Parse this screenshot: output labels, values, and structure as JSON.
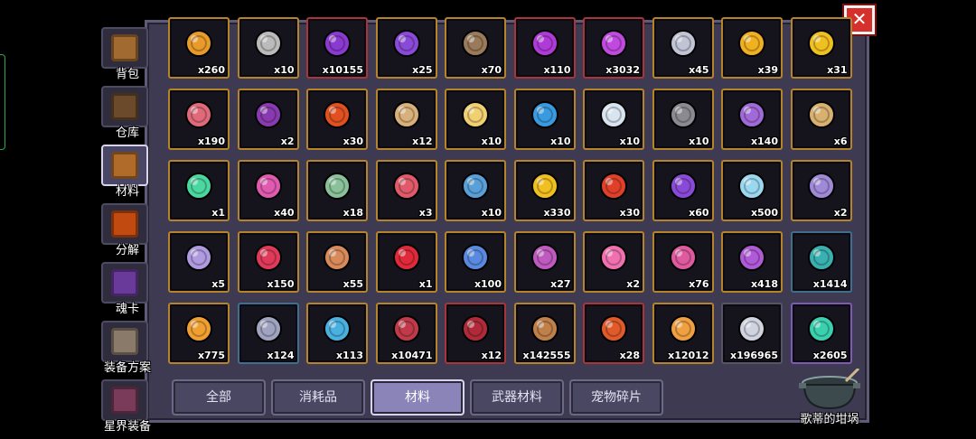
{
  "close_label": "✕",
  "side_tabs": [
    {
      "label": "背包",
      "icon": "chest-icon",
      "color": "#a06a30"
    },
    {
      "label": "仓库",
      "icon": "warehouse-icon",
      "color": "#6a4a2a"
    },
    {
      "label": "材料",
      "icon": "materials-icon",
      "color": "#b06a2a",
      "active": true
    },
    {
      "label": "分解",
      "icon": "salvage-furnace-icon",
      "color": "#c04a10"
    },
    {
      "label": "魂卡",
      "icon": "soul-card-icon",
      "color": "#6a3a9a"
    },
    {
      "label": "装备方案",
      "icon": "equipment-plan-icon",
      "color": "#8a7a6a"
    },
    {
      "label": "星界装备",
      "icon": "astral-gear-icon",
      "color": "#7a3a5a"
    }
  ],
  "items": [
    {
      "name": "lantern-icon",
      "count": "x260",
      "color": "#e89a2a"
    },
    {
      "name": "mystery-box-icon",
      "count": "x10",
      "color": "#bbbbbb"
    },
    {
      "name": "purple-crystal-icon",
      "count": "x10155",
      "color": "#8a3ad0",
      "rarity": "red"
    },
    {
      "name": "purple-ticket-icon",
      "count": "x25",
      "color": "#8a4ad8"
    },
    {
      "name": "ship-icon",
      "count": "x70",
      "color": "#9a7a5a"
    },
    {
      "name": "purple-flame-icon",
      "count": "x110",
      "color": "#b03ad8",
      "rarity": "red"
    },
    {
      "name": "purple-dust-icon",
      "count": "x3032",
      "color": "#c04ae0",
      "rarity": "red"
    },
    {
      "name": "silver-coin-icon",
      "count": "x45",
      "color": "#c0c4d4"
    },
    {
      "name": "gold-coin-icon",
      "count": "x39",
      "color": "#f0b020"
    },
    {
      "name": "puzzle-piece-icon",
      "count": "x31",
      "color": "#f0c020"
    },
    {
      "name": "meat-icon",
      "count": "x190",
      "color": "#e06a7a"
    },
    {
      "name": "dark-orb-icon",
      "count": "x2",
      "color": "#8a3ab0"
    },
    {
      "name": "red-diamond-icon",
      "count": "x30",
      "color": "#e05020"
    },
    {
      "name": "scroll-icon",
      "count": "x12",
      "color": "#d8b07a"
    },
    {
      "name": "golden-butterfly-icon",
      "count": "x10",
      "color": "#f0d070"
    },
    {
      "name": "blue-cloud-icon",
      "count": "x10",
      "color": "#3a9ae0"
    },
    {
      "name": "white-bunny-icon",
      "count": "x10",
      "color": "#d8e4f0"
    },
    {
      "name": "skull-orb-icon",
      "count": "x10",
      "color": "#8a8a90"
    },
    {
      "name": "lightning-orb-icon",
      "count": "x140",
      "color": "#a06ad8"
    },
    {
      "name": "map-icon",
      "count": "x6",
      "color": "#d8b070"
    },
    {
      "name": "green-vial-icon",
      "count": "x1",
      "color": "#4ad8a0"
    },
    {
      "name": "popsicle-icon",
      "count": "x40",
      "color": "#e05ab0"
    },
    {
      "name": "green-scroll-icon",
      "count": "x18",
      "color": "#8ac09a"
    },
    {
      "name": "red-vial-icon",
      "count": "x3",
      "color": "#e05a6a"
    },
    {
      "name": "blue-medal-icon",
      "count": "x10",
      "color": "#5aa0d8"
    },
    {
      "name": "ginkgo-leaf-icon",
      "count": "x330",
      "color": "#f0c020"
    },
    {
      "name": "number-three-coin-icon",
      "count": "x30",
      "color": "#e0402a"
    },
    {
      "name": "purple-mask-icon",
      "count": "x60",
      "color": "#8a4ad8"
    },
    {
      "name": "ice-butterfly-icon",
      "count": "x500",
      "color": "#9ad8f0"
    },
    {
      "name": "target-card-icon",
      "count": "x2",
      "color": "#a08ad8"
    },
    {
      "name": "purple-card-icon",
      "count": "x5",
      "color": "#b09ae0"
    },
    {
      "name": "heart-orb-icon",
      "count": "x150",
      "color": "#e03a5a"
    },
    {
      "name": "bone-icon",
      "count": "x55",
      "color": "#d88a5a"
    },
    {
      "name": "christmas-sock-icon",
      "count": "x1",
      "color": "#e02a3a"
    },
    {
      "name": "blue-gem-icon",
      "count": "x100",
      "color": "#5a8ae0"
    },
    {
      "name": "paw-orb-icon",
      "count": "x27",
      "color": "#c05ac0"
    },
    {
      "name": "pink-paw-icon",
      "count": "x2",
      "color": "#f070b0"
    },
    {
      "name": "pink-chest-icon",
      "count": "x76",
      "color": "#e05aa0"
    },
    {
      "name": "purple-chest-icon",
      "count": "x418",
      "color": "#b05ad8"
    },
    {
      "name": "teal-chest-icon",
      "count": "x1414",
      "color": "#3ab0b0",
      "rarity": "blue"
    },
    {
      "name": "orange-chest-icon",
      "count": "x775",
      "color": "#f0a030"
    },
    {
      "name": "silver-chest-icon",
      "count": "x124",
      "color": "#a0a4c0",
      "rarity": "blue"
    },
    {
      "name": "star-jar-icon",
      "count": "x113",
      "color": "#4ab0e0"
    },
    {
      "name": "red-ore-icon",
      "count": "x10471",
      "color": "#c03a4a"
    },
    {
      "name": "demon-mask-icon",
      "count": "x12",
      "color": "#b02a3a",
      "rarity": "red"
    },
    {
      "name": "bronze-rune-icon",
      "count": "x142555",
      "color": "#c0804a"
    },
    {
      "name": "fire-pile-icon",
      "count": "x28",
      "color": "#e05a2a",
      "rarity": "red"
    },
    {
      "name": "orange-pile-icon",
      "count": "x12012",
      "color": "#f0a040"
    },
    {
      "name": "silver-pile-icon",
      "count": "x196965",
      "color": "#d0d4e0",
      "rarity": "gray"
    },
    {
      "name": "emerald-icon",
      "count": "x2605",
      "color": "#3ad0b0",
      "rarity": "purple"
    }
  ],
  "bottom_tabs": [
    {
      "label": "全部"
    },
    {
      "label": "消耗品"
    },
    {
      "label": "材料",
      "active": true
    },
    {
      "label": "武器材料"
    },
    {
      "label": "宠物碎片"
    }
  ],
  "pot_label": "歌蒂的坩埚"
}
